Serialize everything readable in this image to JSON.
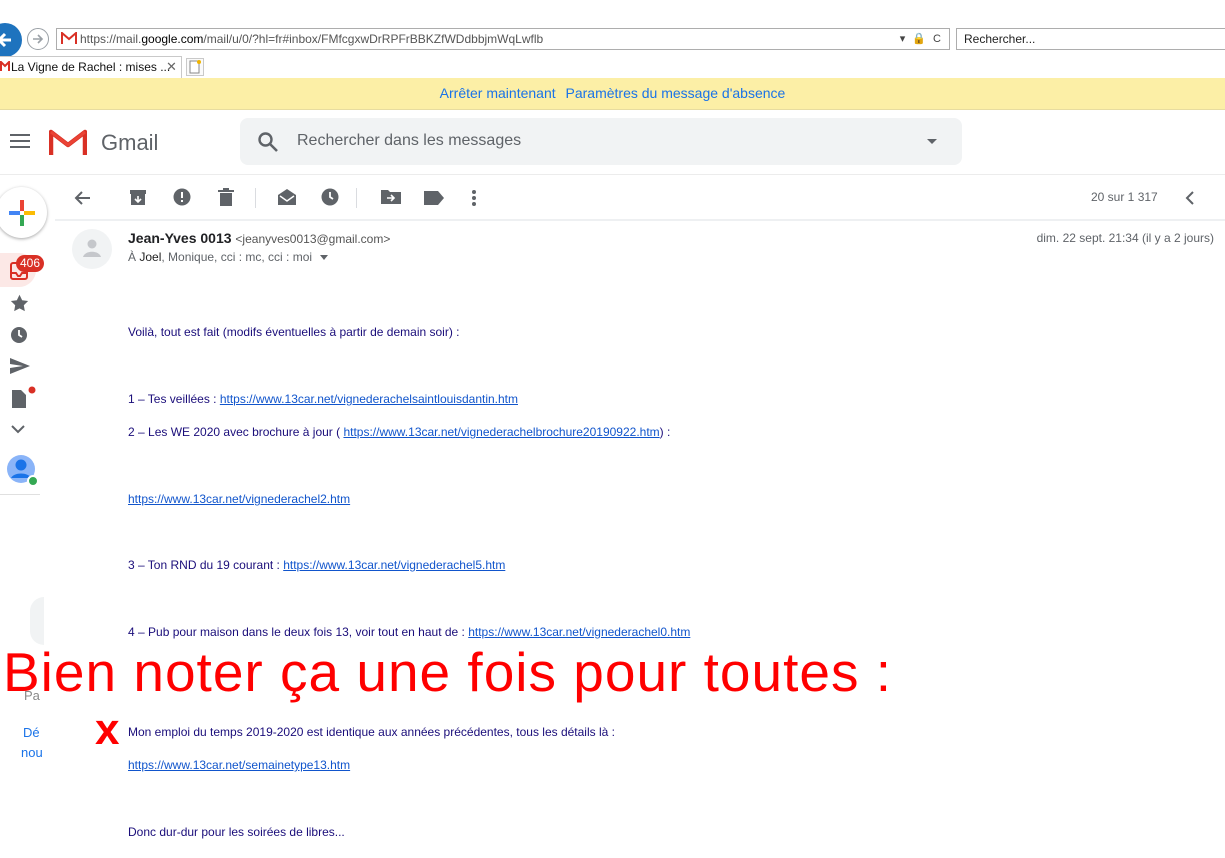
{
  "browser": {
    "url_prefix": "https://mail.",
    "url_domain": "google.com",
    "url_rest": "/mail/u/0/?hl=fr#inbox/FMfcgxwDrRPFrBBKZfWDdbbjmWqLwflb",
    "url_tools": "▾ 🔒 C",
    "search_placeholder": "Rechercher...",
    "tab_title": "La Vigne de Rachel : mises ...",
    "tab_close": "✕"
  },
  "banner": {
    "stop_label": "Arrêter maintenant",
    "settings_label": "Paramètres du message d'absence"
  },
  "gmail": {
    "brand": "Gmail",
    "search_placeholder": "Rechercher dans les messages",
    "inbox_count": "406"
  },
  "toolbar": {
    "counter": "20 sur 1 317"
  },
  "message": {
    "sender_name": "Jean-Yves 0013",
    "sender_email": "<jeanyves0013@gmail.com>",
    "recipients_prefix": "À ",
    "recipients_main": "Joel",
    "recipients_rest": ", Monique, cci : mc, cci : moi",
    "date": "dim. 22 sept. 21:34 (il y a 2 jours)"
  },
  "body": {
    "l1": "Voilà, tout est fait (modifs éventuelles à partir de demain soir) :",
    "l2_text": "1 – Tes veillées : ",
    "l2_link": "https://www.13car.net/vignederachelsaintlouisdantin.htm",
    "l3_text": "2 – Les WE 2020  avec brochure à jour ( ",
    "l3_link": "https://www.13car.net/vignederachelbrochure20190922.htm",
    "l3_end": ")  :",
    "l4_link": "https://www.13car.net/vignederachel2.htm",
    "l5_text": "3 – Ton RND du 19 courant : ",
    "l5_link": "https://www.13car.net/vignederachel5.htm",
    "l6_text": "4 – Pub pour maison dans le deux fois 13, voir tout en haut de : ",
    "l6_link": "https://www.13car.net/vignederachel0.htm",
    "l7": "Mon emploi du temps 2019-2020 est identique aux années précédentes, tous les détails là :",
    "l8_link": "https://www.13car.net/semainetype13.htm",
    "l9": "Donc dur-dur pour les soirées de libres..."
  },
  "rail": {
    "faded_label": "Pa",
    "blue1": "Dé",
    "blue2": "nou"
  },
  "overlay": {
    "headline": "Bien noter ça une fois pour toutes   :",
    "mark": "x"
  },
  "colors": {
    "banner_bg": "#fcefa6",
    "link": "#1155cc",
    "body_text": "#1a0d7a",
    "overlay_red": "#ff0000",
    "badge_red": "#d93025"
  }
}
